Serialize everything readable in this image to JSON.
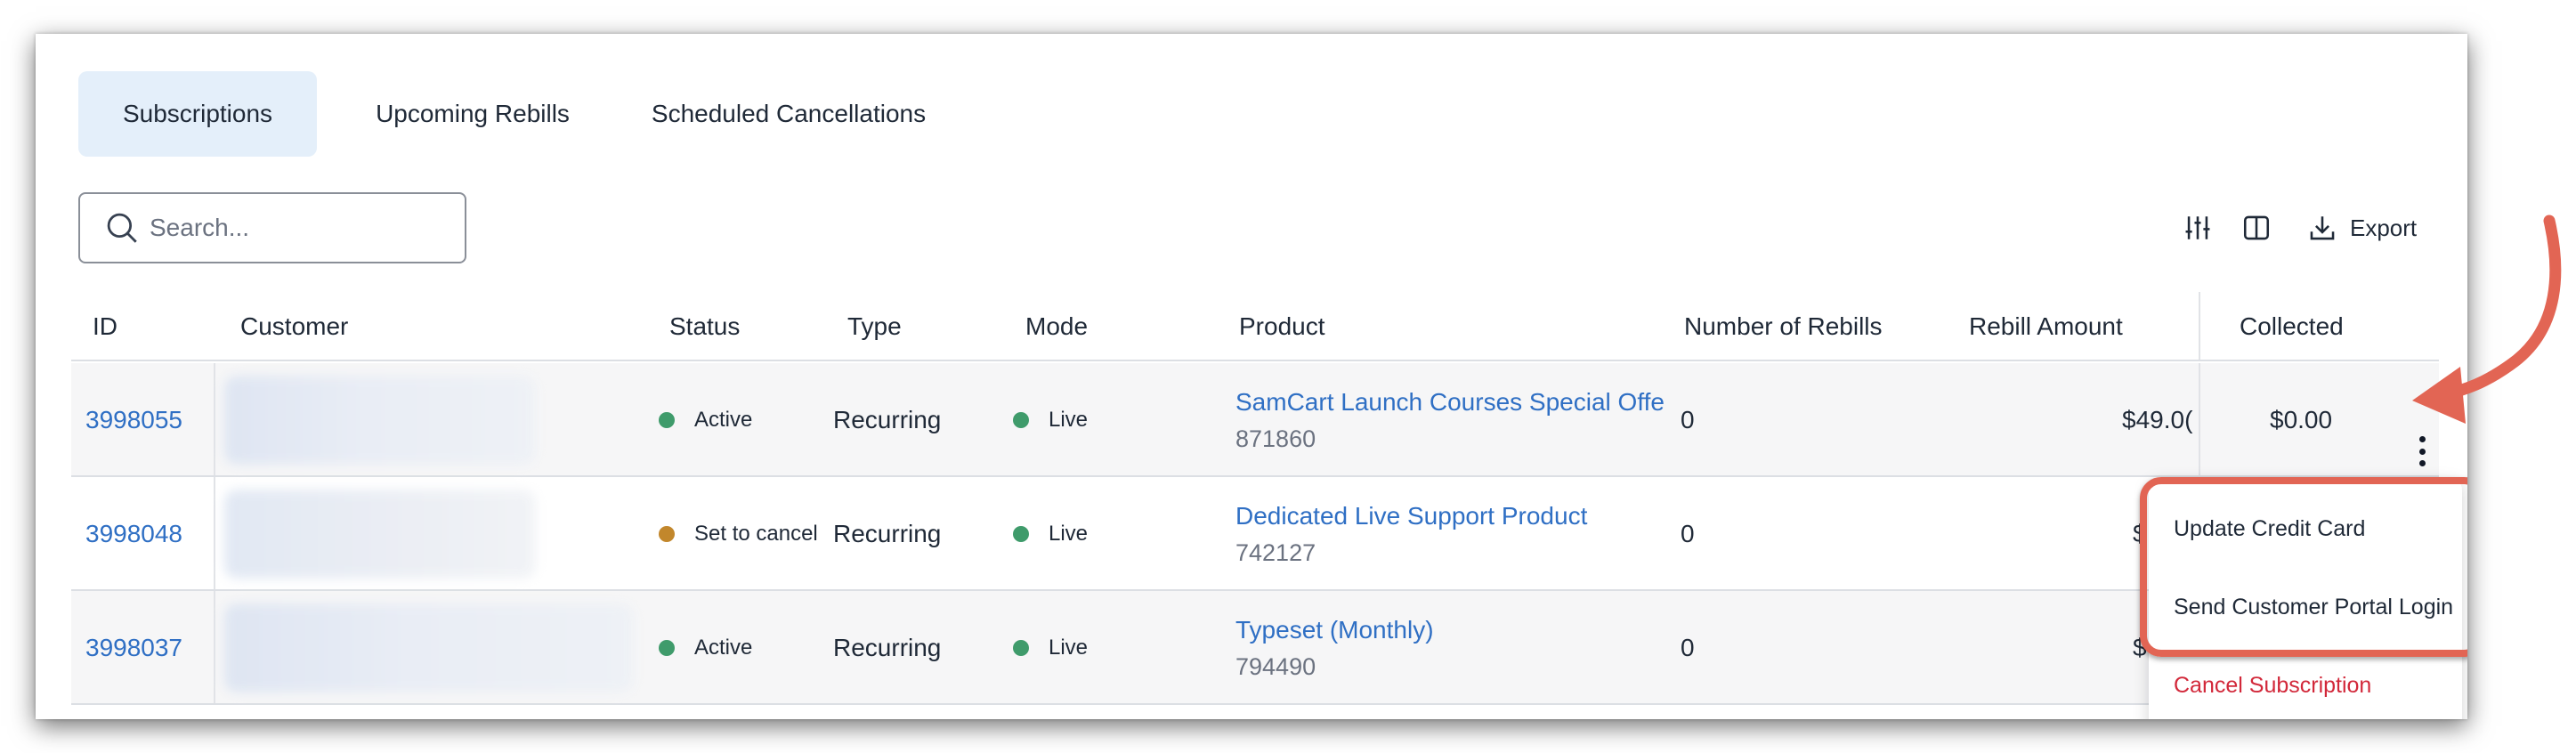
{
  "tabs": [
    "Subscriptions",
    "Upcoming Rebills",
    "Scheduled Cancellations"
  ],
  "search": {
    "placeholder": "Search..."
  },
  "toolbar": {
    "export_label": "Export"
  },
  "columns": [
    "ID",
    "Customer",
    "Status",
    "Type",
    "Mode",
    "Product",
    "Number of Rebills",
    "Rebill Amount",
    "Collected"
  ],
  "rows": [
    {
      "id": "3998055",
      "status": "Active",
      "type": "Recurring",
      "mode": "Live",
      "product_name": "SamCart Launch Courses Special Offe",
      "product_code": "871860",
      "rebills": "0",
      "rebill_amount": "$49.0(",
      "collected": "$0.00"
    },
    {
      "id": "3998048",
      "status": "Set to cancel",
      "type": "Recurring",
      "mode": "Live",
      "product_name": "Dedicated Live Support Product",
      "product_code": "742127",
      "rebills": "0",
      "rebill_amount": "$",
      "collected": ""
    },
    {
      "id": "3998037",
      "status": "Active",
      "type": "Recurring",
      "mode": "Live",
      "product_name": "Typeset (Monthly)",
      "product_code": "794490",
      "rebills": "0",
      "rebill_amount": "$",
      "collected": ""
    }
  ],
  "menu": {
    "items": [
      "Update Credit Card",
      "Send Customer Portal Login",
      "Cancel Subscription"
    ]
  },
  "colors": {
    "link": "#2f6fc4",
    "active_dot": "#3f9b6b",
    "cancel_dot": "#c2872c",
    "live_dot": "#3f9b6b",
    "danger": "#d2283a",
    "annotation": "#e26554",
    "tab_active_bg": "#e4effa"
  },
  "icons": [
    "search-icon",
    "filter-sliders-icon",
    "columns-icon",
    "download-icon",
    "more-vertical-icon",
    "annotation-arrow-icon"
  ]
}
